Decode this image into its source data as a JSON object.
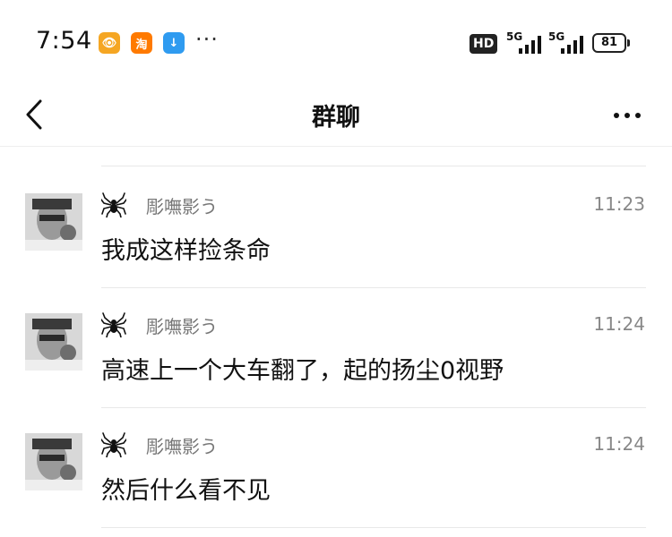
{
  "status_bar": {
    "time": "7:54",
    "apps": [
      {
        "icon": "weibo-eye-icon",
        "glyph": "👁"
      },
      {
        "icon": "taobao-icon",
        "glyph": "淘"
      },
      {
        "icon": "download-icon",
        "glyph": "↓"
      }
    ],
    "more": "···",
    "hd": "HD",
    "network1": "5G",
    "network2": "5G",
    "battery": "81"
  },
  "nav": {
    "title": "群聊",
    "back_icon": "chevron-left-icon",
    "more_icon": "more-horizontal-icon"
  },
  "messages": [
    {
      "sender": "彫嘸影う",
      "time": "11:23",
      "text": "我成这样捡条命"
    },
    {
      "sender": "彫嘸影う",
      "time": "11:24",
      "text": "高速上一个大车翻了，起的扬尘0视野"
    },
    {
      "sender": "彫嘸影う",
      "time": "11:24",
      "text": "然后什么看不见"
    }
  ]
}
